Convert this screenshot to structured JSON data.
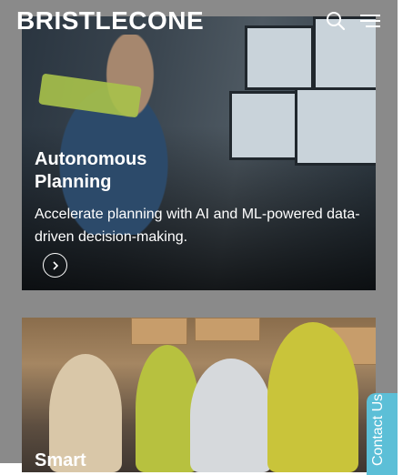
{
  "header": {
    "logo_text": "BRISTLECONE",
    "search_icon": "search-icon",
    "menu_icon": "hamburger-menu-icon"
  },
  "cards": [
    {
      "title_line1": "Autonomous",
      "title_line2": "Planning",
      "description": "Accelerate planning with AI and ML-powered data-driven decision-making.",
      "link_icon": "chevron-right-icon"
    },
    {
      "title_line1": "Smart"
    }
  ],
  "contact_tab": {
    "label": "Contact Us"
  },
  "colors": {
    "panel_gray": "#8a8a8a",
    "contact_tab": "#5cbfd7",
    "text": "#ffffff"
  }
}
